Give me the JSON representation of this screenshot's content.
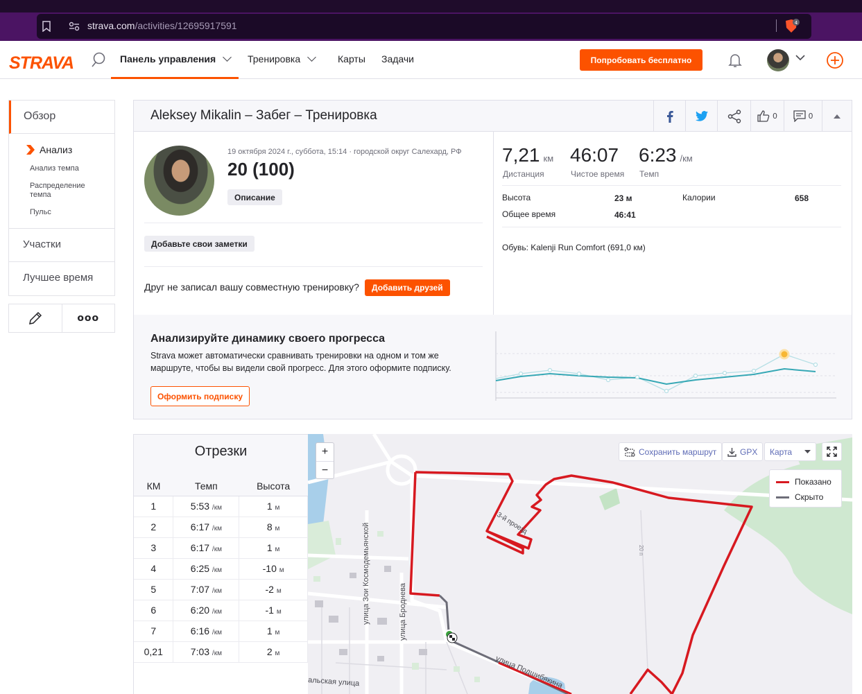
{
  "browser": {
    "url_host": "strava.com",
    "url_path": "/activities/12695917591",
    "shield_count": "4"
  },
  "nav": {
    "logo": "STRAVA",
    "dashboard": "Панель управления",
    "training": "Тренировка",
    "maps": "Карты",
    "tasks": "Задачи",
    "try_free": "Попробовать бесплатно"
  },
  "sidebar": {
    "overview": "Обзор",
    "analysis": "Анализ",
    "pace_analysis": "Анализ темпа",
    "pace_distribution": "Распределение темпа",
    "heart_rate": "Пульс",
    "segments": "Участки",
    "best_efforts": "Лучшее время",
    "more": "ooo"
  },
  "activity": {
    "title": "Aleksey Mikalin – Забег – Тренировка",
    "kudos_count": "0",
    "comments_count": "0",
    "date": "19 октября 2024 г., суббота, 15:14 · городской округ Салехард, РФ",
    "name": "20 (100)",
    "description_btn": "Описание",
    "notes_btn": "Добавьте свои заметки",
    "friend_question": "Друг не записал вашу совместную тренировку?",
    "add_friends_btn": "Добавить друзей"
  },
  "stats": {
    "distance_value": "7,21",
    "distance_unit": "км",
    "distance_label": "Дистанция",
    "moving_time_value": "46:07",
    "moving_time_label": "Чистое время",
    "pace_value": "6:23",
    "pace_unit": "/км",
    "pace_label": "Темп",
    "elevation_label": "Высота",
    "elevation_value": "23 м",
    "calories_label": "Калории",
    "calories_value": "658",
    "elapsed_label": "Общее время",
    "elapsed_value": "46:41",
    "shoes": "Обувь: Kalenji Run Comfort (691,0 км)"
  },
  "upsell": {
    "title": "Анализируйте динамику своего прогресса",
    "text": "Strava может автоматически сравнивать тренировки на одном и том же маршруте, чтобы вы видели свой прогресс. Для этого оформите подписку.",
    "button": "Оформить подписку"
  },
  "splits": {
    "title": "Отрезки",
    "headers": [
      "КМ",
      "Темп",
      "Высота"
    ],
    "rows": [
      {
        "km": "1",
        "pace": "5:53",
        "elev": "1"
      },
      {
        "km": "2",
        "pace": "6:17",
        "elev": "8"
      },
      {
        "km": "3",
        "pace": "6:17",
        "elev": "1"
      },
      {
        "km": "4",
        "pace": "6:25",
        "elev": "-10"
      },
      {
        "km": "5",
        "pace": "7:07",
        "elev": "-2"
      },
      {
        "km": "6",
        "pace": "6:20",
        "elev": "-1"
      },
      {
        "km": "7",
        "pace": "6:16",
        "elev": "1"
      },
      {
        "km": "0,21",
        "pace": "7:03",
        "elev": "2"
      }
    ],
    "pace_unit": "/км",
    "elev_unit": "м"
  },
  "map": {
    "zoom_in": "+",
    "zoom_out": "−",
    "save_route": "Сохранить маршрут",
    "gpx": "GPX",
    "map_type": "Карта",
    "legend_shown": "Показано",
    "legend_hidden": "Скрыто",
    "street_1": "улица Зои Космодемьянской",
    "street_2": "улица Броднева",
    "street_3": "улица Подшибякина",
    "street_4": "альская улица",
    "street_5": "3-й проезд",
    "road_label": "20 п",
    "route_color": "#d71920",
    "hidden_color": "#6d6d78"
  },
  "colors": {
    "accent": "#fc5200"
  }
}
